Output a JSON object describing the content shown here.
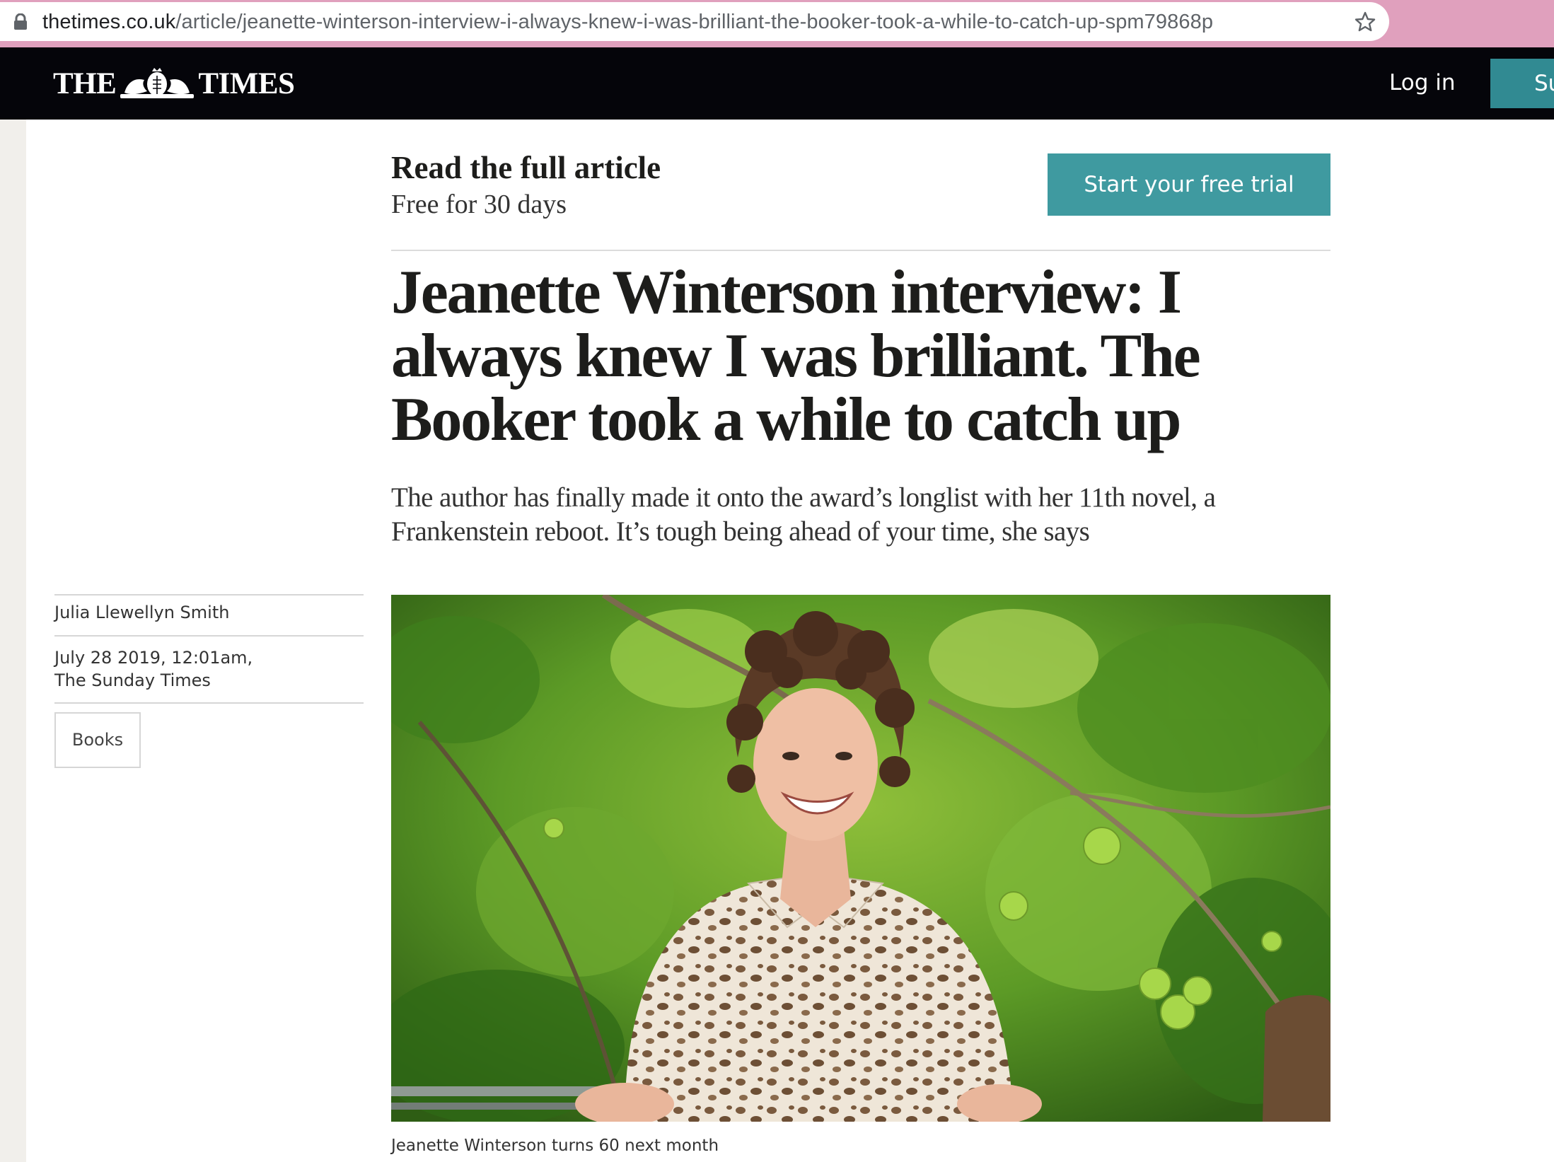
{
  "browser": {
    "url_domain": "thetimes.co.uk",
    "url_path": "/article/jeanette-winterson-interview-i-always-knew-i-was-brilliant-the-booker-took-a-while-to-catch-up-spm79868p",
    "icons": [
      "lock-icon",
      "star-icon"
    ]
  },
  "masthead": {
    "logo_left": "THE",
    "logo_right": "TIMES",
    "login_label": "Log in",
    "subscribe_label": "Su",
    "colors": {
      "background": "#05050a",
      "subscribe": "#318a92"
    }
  },
  "promo": {
    "title": "Read the full article",
    "subtitle": "Free for 30 days",
    "trial_button": "Start your free trial",
    "button_color": "#3f9aa0"
  },
  "article": {
    "headline": "Jeanette Winterson interview: I always knew I was brilliant. The Booker took a while to catch up",
    "standfirst": "The author has finally made it onto the award’s longlist with her 11th novel, a Frankenstein reboot. It’s tough being ahead of your time, she says",
    "author": "Julia Llewellyn Smith",
    "date": "July 28 2019, 12:01am,",
    "publication": "The Sunday Times",
    "tag": "Books",
    "photo_caption": "Jeanette Winterson turns 60 next month"
  }
}
